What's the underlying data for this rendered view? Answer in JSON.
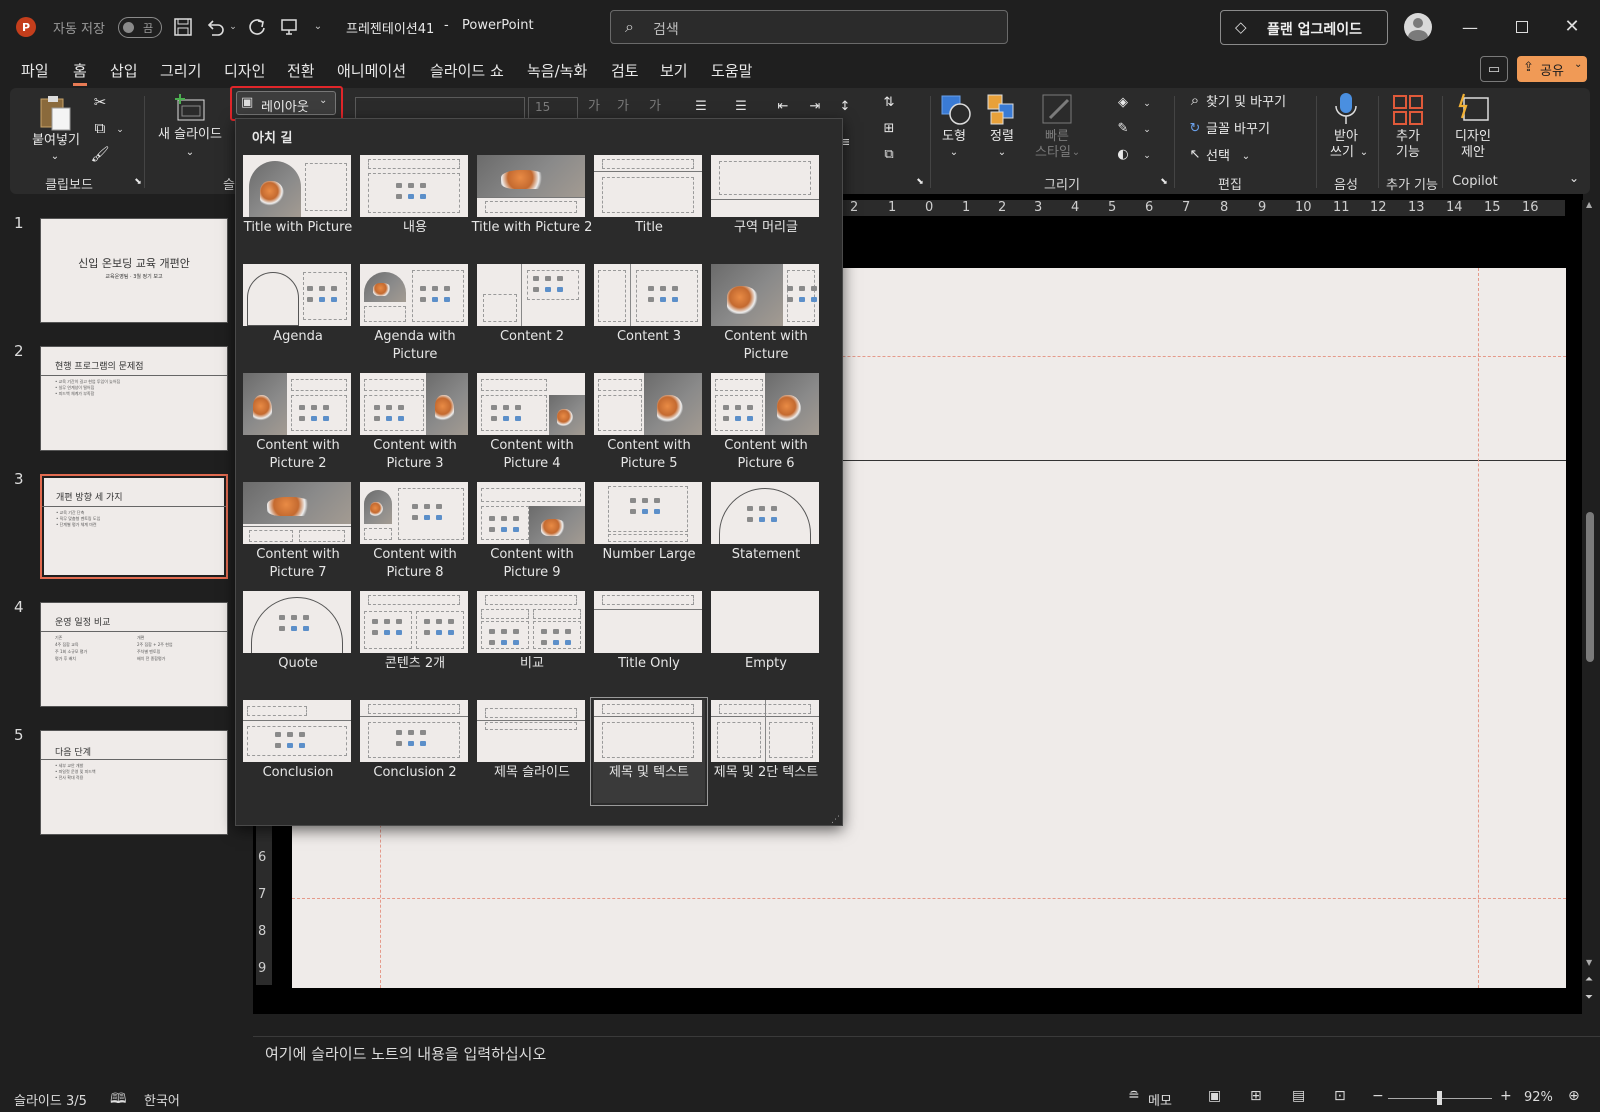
{
  "titlebar": {
    "autosave_label": "자동 저장",
    "autosave_state": "끔",
    "doc_title": "프레젠테이션41",
    "separator": "-",
    "app_name": "PowerPoint",
    "search_placeholder": "검색",
    "upgrade_label": "플랜 업그레이드"
  },
  "menu": {
    "items": [
      "파일",
      "홈",
      "삽입",
      "그리기",
      "디자인",
      "전환",
      "애니메이션",
      "슬라이드 쇼",
      "녹음/녹화",
      "검토",
      "보기",
      "도움말"
    ],
    "active": "홈",
    "share_label": "공유"
  },
  "ribbon": {
    "paste": "붙여넣기",
    "clipboard_group": "클립보드",
    "new_slide": "새 슬라이드",
    "slides_group_partial": "슬",
    "layout_button": "레이아웃",
    "font_size": "15",
    "shapes": "도형",
    "arrange": "정렬",
    "quick_styles_1": "빠른",
    "quick_styles_2": "스타일",
    "draw_group": "그리기",
    "find_replace": "찾기 및 바꾸기",
    "font_replace": "글꼴 바꾸기",
    "select": "선택",
    "edit_group": "편집",
    "dictate_1": "받아",
    "dictate_2": "쓰기",
    "voice_group": "음성",
    "addins_1": "추가",
    "addins_2": "기능",
    "addins_group": "추가 기능",
    "designer_1": "디자인",
    "designer_2": "제안",
    "copilot_group": "Copilot"
  },
  "layout_gallery": {
    "theme_name": "아치 길",
    "layouts": [
      "Title with Picture",
      "내용",
      "Title with Picture 2",
      "Title",
      "구역 머리글",
      "Agenda",
      "Agenda with Picture",
      "Content 2",
      "Content 3",
      "Content with Picture",
      "Content with Picture 2",
      "Content with Picture 3",
      "Content with Picture 4",
      "Content with Picture 5",
      "Content with Picture 6",
      "Content with Picture 7",
      "Content with Picture 8",
      "Content with Picture 9",
      "Number Large",
      "Statement",
      "Quote",
      "콘텐츠 2개",
      "비교",
      "Title Only",
      "Empty",
      "Conclusion",
      "Conclusion 2",
      "제목 슬라이드",
      "제목 및 텍스트",
      "제목 및 2단 텍스트"
    ],
    "selected": "제목 및 텍스트"
  },
  "slides": [
    {
      "num": "1",
      "title": "신입 온보딩 교육 개편안",
      "subtitle": "교육운영팀 · 3월 정기 보고"
    },
    {
      "num": "2",
      "title": "현행 프로그램의 문제점",
      "lines": [
        "• 교육 기간이 길고 현업 투입이 늦어짐",
        "• 실무 연계성이 떨어짐",
        "• 피드백 체계가 부족함"
      ]
    },
    {
      "num": "3",
      "title": "개편 방향 세 가지",
      "lines": [
        "• 교육 기간 단축",
        "• 직무 맞춤형 멘토링 도입",
        "• 단계별 평가 체계 마련"
      ]
    },
    {
      "num": "4",
      "title": "운영 일정 비교",
      "col1": [
        "기존",
        "4주 집합 교육",
        "주 1회 소규모 평가",
        "평가 후 배치"
      ],
      "col2": [
        "개편",
        "2주 집합 + 2주 현업",
        "주차별 멘토링",
        "배치 전 종합평가"
      ]
    },
    {
      "num": "5",
      "title": "다음 단계",
      "lines": [
        "• 세부 교안 개발",
        "• 파일럿 운영 및 피드백",
        "• 전사 확대 적용"
      ]
    }
  ],
  "selected_slide": "3",
  "ruler": {
    "h_ticks": [
      "2",
      "1",
      "0",
      "1",
      "2",
      "3",
      "4",
      "5",
      "6",
      "7",
      "8",
      "9",
      "10",
      "11",
      "12",
      "13",
      "14",
      "15",
      "16"
    ],
    "v_ticks": [
      "6",
      "7",
      "8",
      "9"
    ]
  },
  "notes_placeholder": "여기에 슬라이드 노트의 내용을 입력하십시오",
  "status": {
    "slide_counter": "슬라이드 3/5",
    "language": "한국어",
    "notes": "메모",
    "zoom": "92%"
  },
  "colors": {
    "accent": "#e26b50",
    "share": "#f09a56",
    "upgrade_border": "#8a8a8a"
  }
}
